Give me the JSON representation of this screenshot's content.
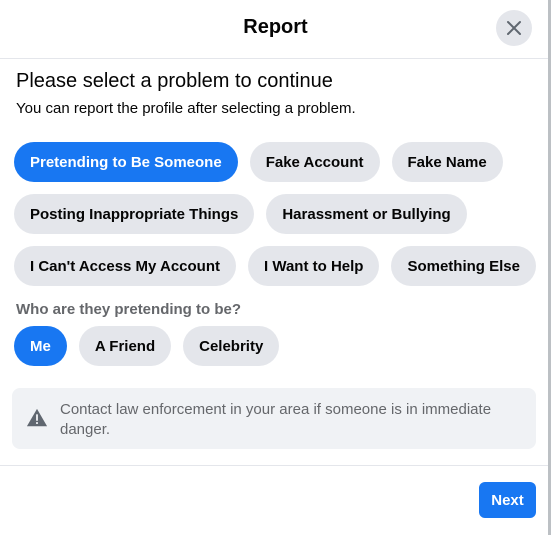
{
  "header": {
    "title": "Report",
    "close_icon": "close-icon"
  },
  "main": {
    "heading": "Please select a problem to continue",
    "subheading": "You can report the profile after selecting a problem.",
    "problems": [
      "Pretending to Be Someone",
      "Fake Account",
      "Fake Name",
      "Posting Inappropriate Things",
      "Harassment or Bullying",
      "I Can't Access My Account",
      "I Want to Help",
      "Something Else"
    ],
    "selected_problem": "Pretending to Be Someone",
    "question": "Who are they pretending to be?",
    "who_options": [
      "Me",
      "A Friend",
      "Celebrity"
    ],
    "selected_who": "Me"
  },
  "warning": {
    "icon": "warning-triangle-icon",
    "text": "Contact law enforcement in your area if someone is in immediate danger."
  },
  "footer": {
    "next_label": "Next"
  },
  "colors": {
    "accent": "#1877f2",
    "chip_bg": "#e4e6eb",
    "secondary_text": "#65676b"
  }
}
